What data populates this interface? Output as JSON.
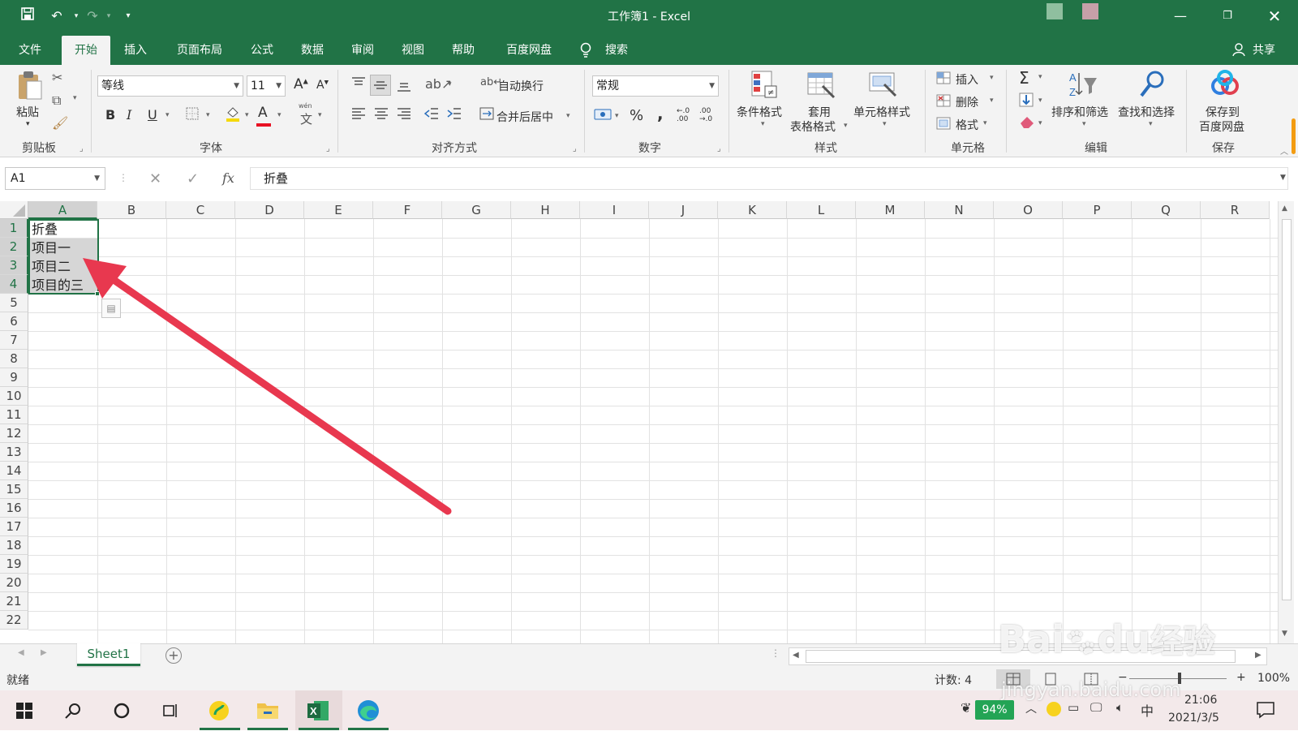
{
  "window": {
    "title": "工作簿1  -  Excel",
    "quick_access": [
      "save-icon",
      "undo-icon",
      "redo-icon",
      "customize-icon"
    ],
    "controls": [
      "minimize-icon",
      "restore-icon",
      "close-icon"
    ]
  },
  "menu": {
    "tabs": [
      "文件",
      "开始",
      "插入",
      "页面布局",
      "公式",
      "数据",
      "审阅",
      "视图",
      "帮助",
      "百度网盘"
    ],
    "active": "开始",
    "search_label": "搜索",
    "share_label": "共享"
  },
  "ribbon": {
    "clipboard": {
      "paste": "粘贴",
      "label": "剪贴板"
    },
    "font": {
      "name": "等线",
      "size": "11",
      "grow": "A",
      "shrink": "A",
      "bold": "B",
      "italic": "I",
      "underline": "U",
      "color_letter": "A",
      "phonetic": "文",
      "phonetic_top": "wén",
      "label": "字体"
    },
    "alignment": {
      "wrap": "自动换行",
      "merge": "合并后居中",
      "label": "对齐方式"
    },
    "number": {
      "format": "常规",
      "percent": "%",
      "comma": ",",
      "label": "数字",
      "dec_inc": "←.0 .00",
      "dec_dec": ".00 →.0"
    },
    "styles": {
      "conditional": "条件格式",
      "table_line1": "套用",
      "table_line2": "表格格式",
      "cell_styles": "单元格样式",
      "label": "样式"
    },
    "cells": {
      "insert": "插入",
      "delete": "删除",
      "format": "格式",
      "label": "单元格"
    },
    "editing": {
      "sum": "Σ",
      "sort": "排序和筛选",
      "find": "查找和选择",
      "label": "编辑"
    },
    "save": {
      "line1": "保存到",
      "line2": "百度网盘",
      "label": "保存"
    }
  },
  "formula_bar": {
    "name_box": "A1",
    "fx": "fx",
    "value": "折叠"
  },
  "grid": {
    "columns": [
      "A",
      "B",
      "C",
      "D",
      "E",
      "F",
      "G",
      "H",
      "I",
      "J",
      "K",
      "L",
      "M",
      "N",
      "O",
      "P",
      "Q",
      "R"
    ],
    "rows": [
      "1",
      "2",
      "3",
      "4",
      "5",
      "6",
      "7",
      "8",
      "9",
      "10",
      "11",
      "12",
      "13",
      "14",
      "15",
      "16",
      "17",
      "18",
      "19",
      "20",
      "21",
      "22"
    ],
    "cells": [
      "折叠",
      "项目一",
      "项目二",
      "项目的三"
    ]
  },
  "sheets": {
    "active": "Sheet1",
    "add": "+"
  },
  "status": {
    "ready": "就绪",
    "count": "计数: 4",
    "zoom": "100%",
    "minus": "−",
    "plus": "+"
  },
  "taskbar": {
    "battery": "94%",
    "ime": "中",
    "time": "21:06",
    "date": "2021/3/5"
  },
  "watermark": {
    "logo": "Bai",
    "logo2": "du",
    "cn": "经验",
    "url": "jingyan.baidu.com"
  },
  "colors": {
    "excel_green": "#217346",
    "arrow_red": "#e8384f",
    "selection_gray": "#d6d6d6"
  }
}
